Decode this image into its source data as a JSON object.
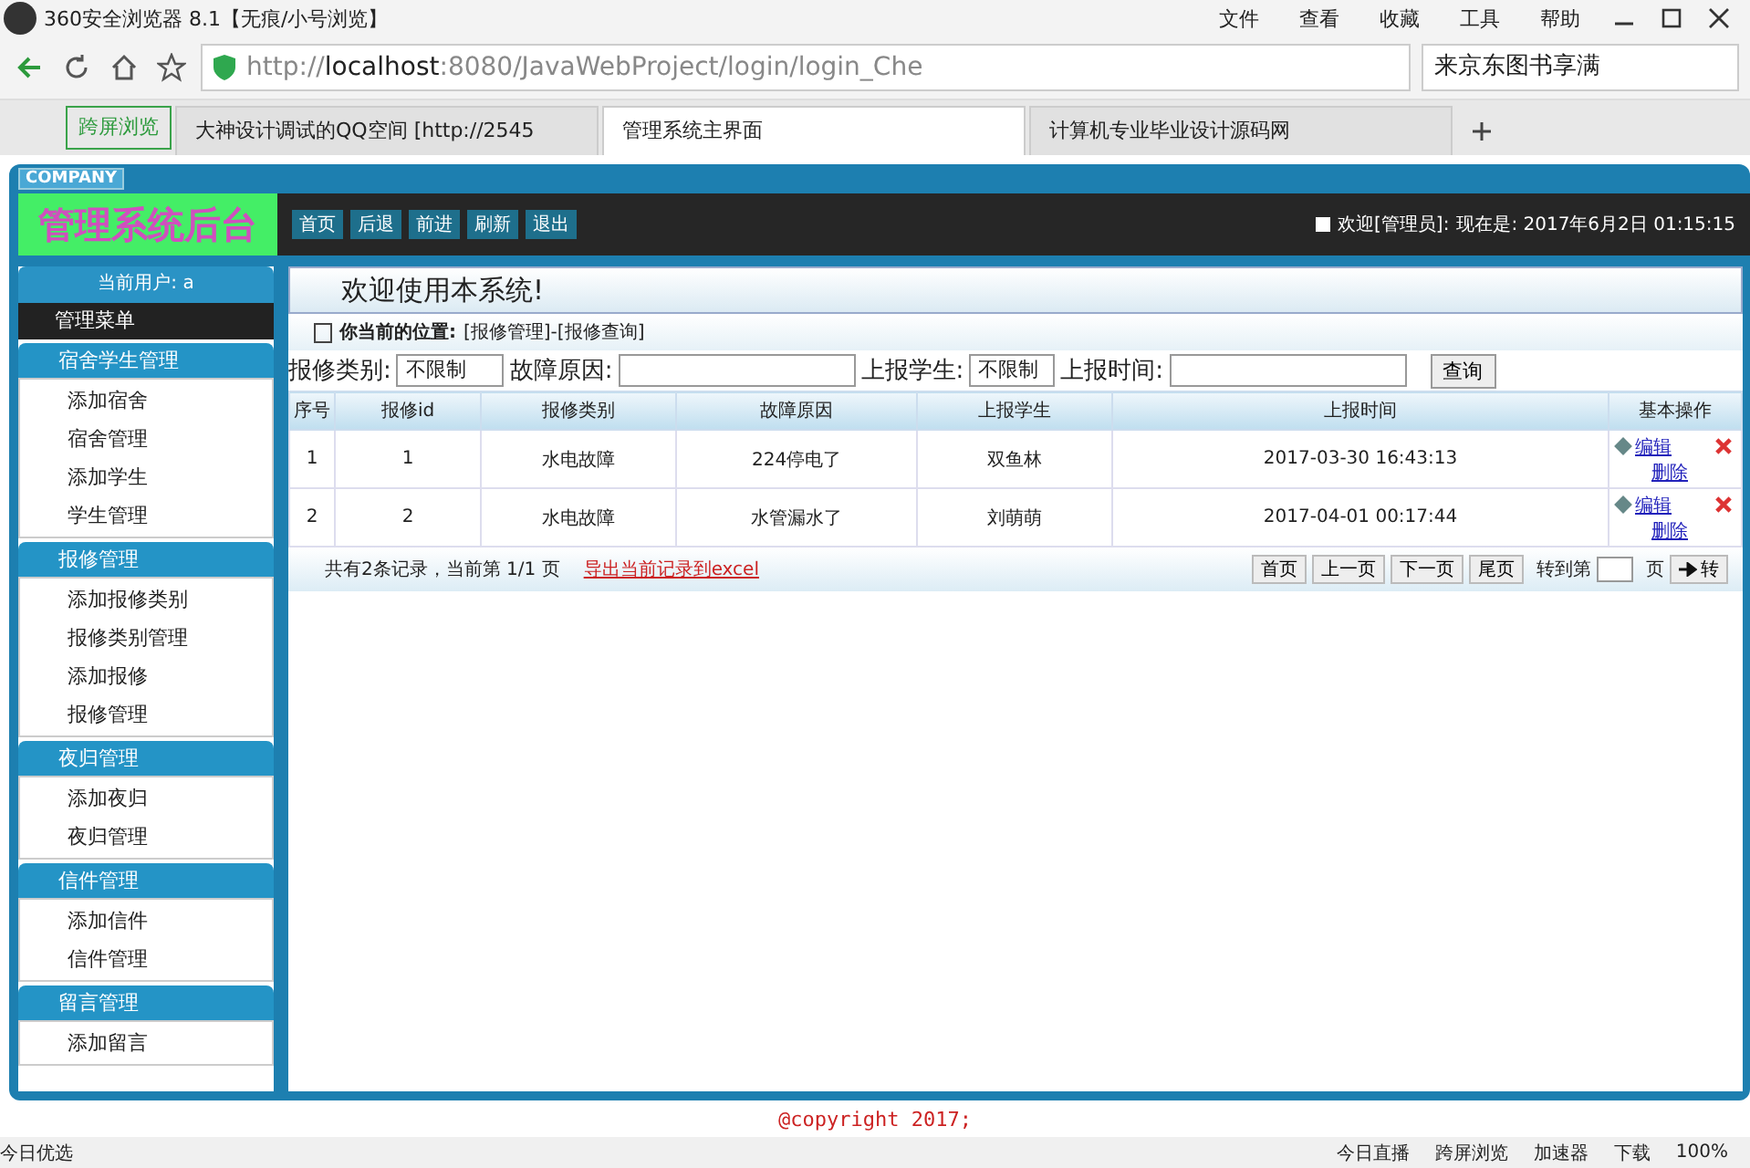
{
  "browser": {
    "title": "360安全浏览器 8.1【无痕/小号浏览】",
    "menu": [
      "文件",
      "查看",
      "收藏",
      "工具",
      "帮助"
    ],
    "url_prefix": "http://",
    "url_host": "localhost",
    "url_rest": ":8080/JavaWebProject/login/login_Che",
    "search": "来京东图书享满",
    "cross_screen": "跨屏浏览",
    "tabs": [
      {
        "label": "大神设计调试的QQ空间 [http://2545",
        "selected": false
      },
      {
        "label": "管理系统主界面",
        "selected": true
      },
      {
        "label": "计算机专业毕业设计源码网",
        "selected": false
      }
    ]
  },
  "page": {
    "company": "COMPANY",
    "app_title": "管理系统后台",
    "toolbar": [
      "首页",
      "后退",
      "前进",
      "刷新",
      "退出"
    ],
    "welcome_prefix": "欢迎[管理员]:",
    "welcome_time": "现在是: 2017年6月2日 01:15:15",
    "current_user": "当前用户: a",
    "menu_title": "管理菜单",
    "banner": "欢迎使用本系统!",
    "sidebar": [
      {
        "title": "宿舍学生管理",
        "items": [
          "添加宿舍",
          "宿舍管理",
          "添加学生",
          "学生管理"
        ]
      },
      {
        "title": "报修管理",
        "items": [
          "添加报修类别",
          "报修类别管理",
          "添加报修",
          "报修管理"
        ]
      },
      {
        "title": "夜归管理",
        "items": [
          "添加夜归",
          "夜归管理"
        ]
      },
      {
        "title": "信件管理",
        "items": [
          "添加信件",
          "信件管理"
        ]
      },
      {
        "title": "留言管理",
        "items": [
          "添加留言"
        ]
      }
    ],
    "location_label": "你当前的位置:",
    "location": "[报修管理]-[报修查询]",
    "filters": {
      "type_label": "报修类别:",
      "type_value": "不限制",
      "reason_label": "故障原因:",
      "student_label": "上报学生:",
      "student_value": "不限制",
      "time_label": "上报时间:",
      "query": "查询"
    },
    "table": {
      "columns": [
        "序号",
        "报修id",
        "报修类别",
        "故障原因",
        "上报学生",
        "上报时间",
        "基本操作"
      ],
      "rows": [
        {
          "cells": [
            "1",
            "1",
            "水电故障",
            "224停电了",
            "双鱼林",
            "2017-03-30 16:43:13"
          ],
          "edit": "编辑",
          "delete": "删除"
        },
        {
          "cells": [
            "2",
            "2",
            "水电故障",
            "水管漏水了",
            "刘萌萌",
            "2017-04-01 00:17:44"
          ],
          "edit": "编辑",
          "delete": "删除"
        }
      ]
    },
    "summary": "共有2条记录，当前第 1/1 页",
    "export": "导出当前记录到excel",
    "pager": [
      "首页",
      "上一页",
      "下一页",
      "尾页"
    ],
    "goto_label": "转到第",
    "goto_unit": "页",
    "goto_button": "转",
    "copyright": "@copyright 2017;"
  },
  "status": {
    "left": "今日优选",
    "right": [
      "今日直播",
      "跨屏浏览",
      "加速器",
      "下载"
    ],
    "zoom": "100%"
  }
}
